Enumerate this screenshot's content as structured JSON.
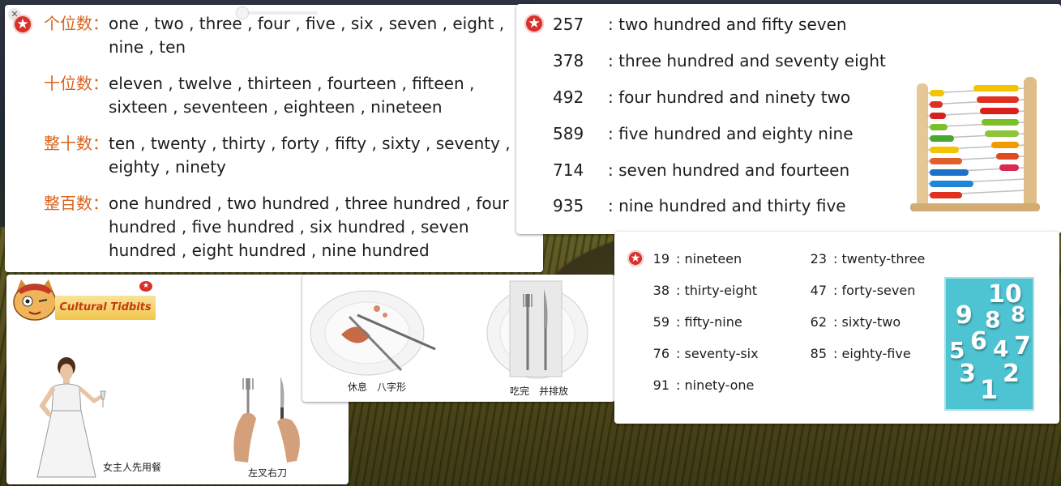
{
  "categories": [
    {
      "label": "个位数：",
      "text": "one , two , three , four , five , six , seven , eight , nine , ten"
    },
    {
      "label": "十位数：",
      "text": "eleven , twelve , thirteen , fourteen , fifteen , sixteen , seventeen , eighteen , nineteen"
    },
    {
      "label": "整十数：",
      "text": "ten , twenty , thirty , forty , fifty , sixty , seventy , eighty , ninety"
    },
    {
      "label": "整百数：",
      "text": "one hundred , two hundred , three hundred , four hundred , five hundred , six hundred , seven hundred , eight hundred , nine hundred"
    }
  ],
  "hundreds": [
    {
      "num": "257",
      "word": ": two hundred and fifty seven"
    },
    {
      "num": "378",
      "word": ": three hundred and seventy eight"
    },
    {
      "num": "492",
      "word": ": four hundred and ninety two"
    },
    {
      "num": "589",
      "word": ": five hundred and eighty nine"
    },
    {
      "num": "714",
      "word": ": seven hundred and fourteen"
    },
    {
      "num": "935",
      "word": ": nine hundred and thirty five"
    }
  ],
  "tens": [
    {
      "num": "19",
      "word": ": nineteen"
    },
    {
      "num": "23",
      "word": ": twenty-three"
    },
    {
      "num": "38",
      "word": ": thirty-eight"
    },
    {
      "num": "47",
      "word": ": forty-seven"
    },
    {
      "num": "59",
      "word": ": fifty-nine"
    },
    {
      "num": "62",
      "word": ": sixty-two"
    },
    {
      "num": "76",
      "word": ": seventy-six"
    },
    {
      "num": "85",
      "word": ": eighty-five"
    },
    {
      "num": "91",
      "word": ": ninety-one"
    }
  ],
  "tidbits": {
    "banner": "Cultural Tidbits",
    "caption_hostess": "女主人先用餐",
    "caption_fork_knife": "左叉右刀"
  },
  "plates": {
    "caption_rest": "休息　八字形",
    "caption_done": "吃完　并排放"
  },
  "icons": {
    "star": "star-icon",
    "close": "close-icon"
  },
  "colors": {
    "category_label": "#d9631c",
    "star_badge": "#d9302b",
    "number_card": "#4ec3d2"
  }
}
